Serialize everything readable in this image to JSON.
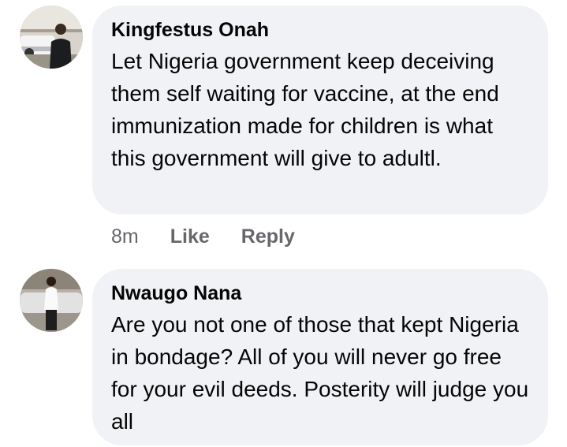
{
  "comments": [
    {
      "author": "Kingfestus Onah",
      "avatar_icon": "profile-photo-man-by-car",
      "text": "Let Nigeria government keep deceiving them self waiting for vaccine, at the end immunization made for children is what this government will give to adultl.",
      "time": "8m",
      "like_label": "Like",
      "reply_label": "Reply"
    },
    {
      "author": "Nwaugo Nana",
      "avatar_icon": "profile-photo-woman-white-shirt",
      "text": "Are you not one of those that kept Nigeria in bondage? All of you will never go free for your evil deeds. Posterity will judge you all"
    }
  ],
  "colors": {
    "bubble_bg": "#f0f2f5",
    "author_text": "#050505",
    "meta_text": "#65676b"
  }
}
